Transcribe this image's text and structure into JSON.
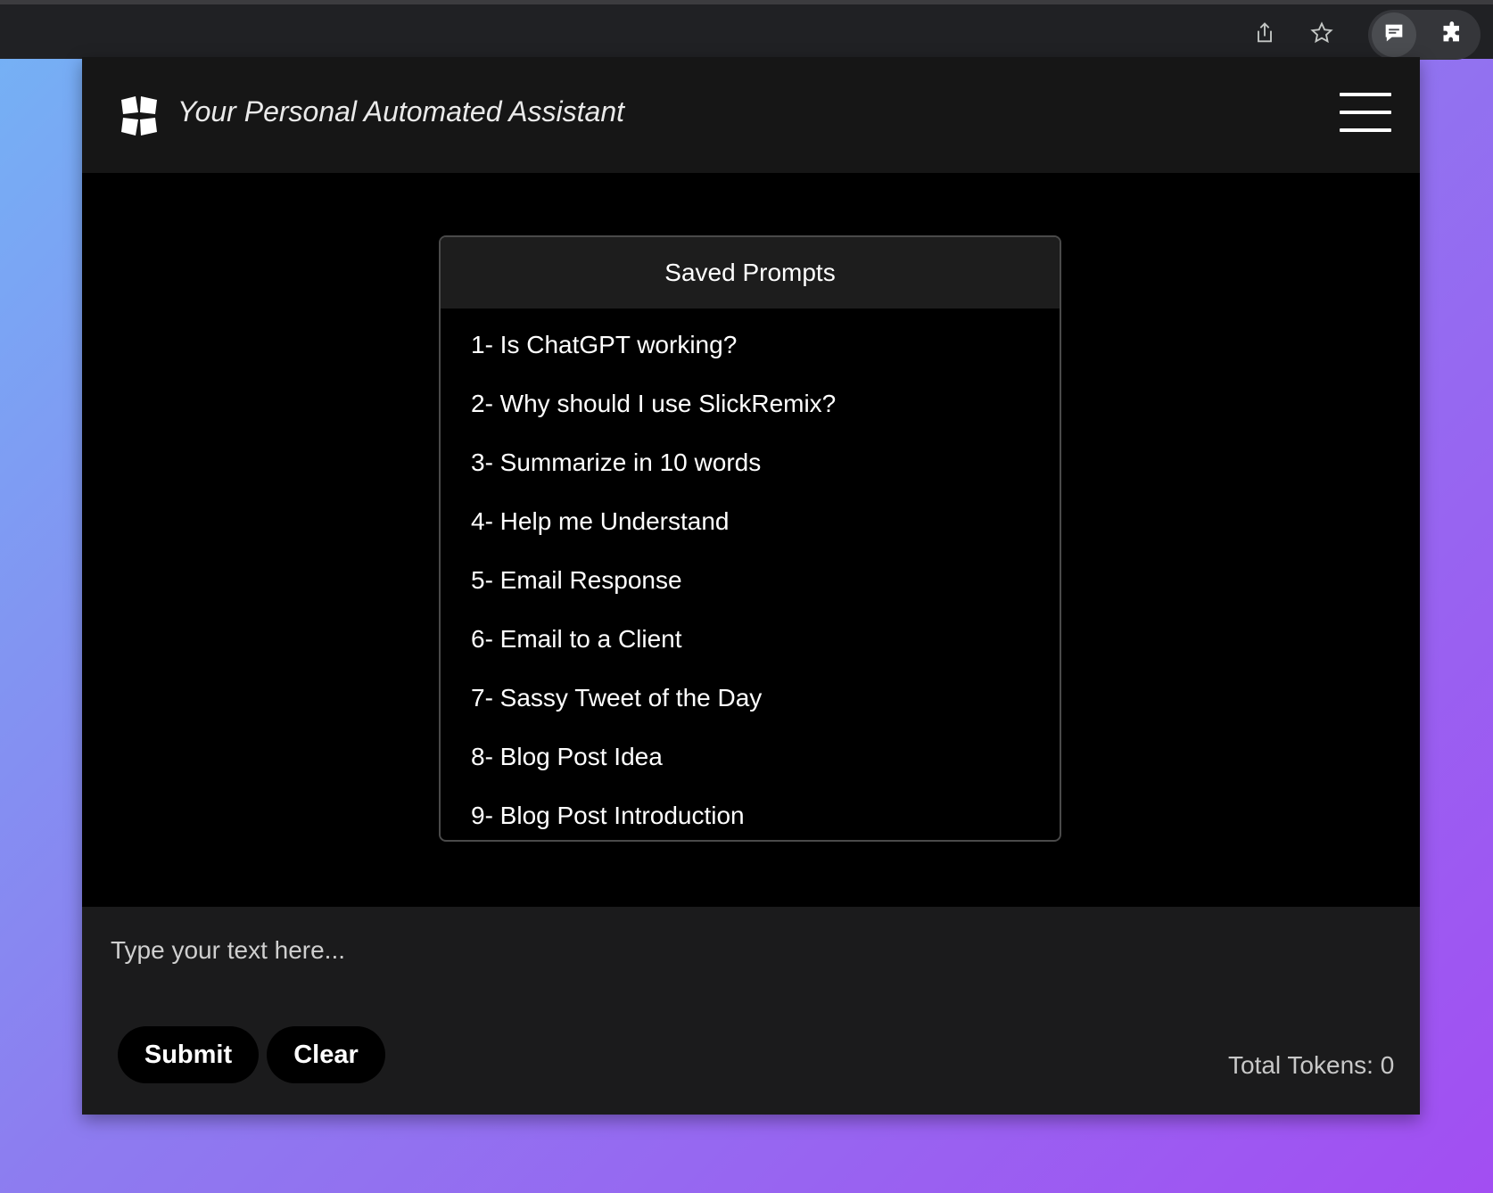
{
  "browser": {
    "share_icon": "share-icon",
    "bookmark_icon": "star-icon",
    "extension_icon": "chat-bubble-icon",
    "extensions_icon": "puzzle-icon"
  },
  "header": {
    "title": "Your Personal Automated Assistant",
    "logo_icon": "logo-icon",
    "menu_icon": "hamburger-menu-icon"
  },
  "saved_prompts": {
    "heading": "Saved Prompts",
    "items": [
      "1- Is ChatGPT working?",
      "2- Why should I use SlickRemix?",
      "3- Summarize in 10 words",
      "4- Help me Understand",
      "5- Email Response",
      "6- Email to a Client",
      "7- Sassy Tweet of the Day",
      "8- Blog Post Idea",
      "9- Blog Post Introduction"
    ]
  },
  "composer": {
    "placeholder": "Type your text here...",
    "value": "",
    "submit_label": "Submit",
    "clear_label": "Clear",
    "tokens_text": "Total Tokens: 0"
  },
  "colors": {
    "accent_gradient_start": "#74b3f5",
    "accent_gradient_end": "#a24ef2",
    "panel": "#000000",
    "header": "#161616",
    "composer": "#1b1b1c"
  }
}
